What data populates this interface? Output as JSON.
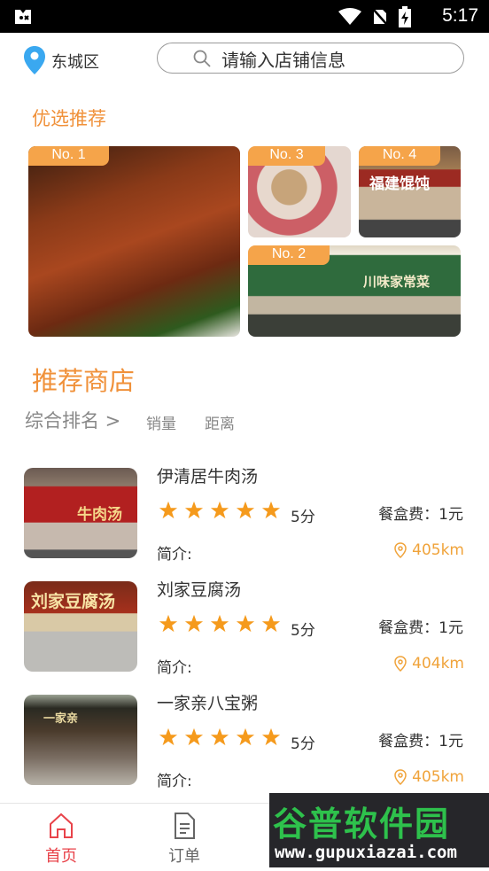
{
  "status_bar": {
    "time": "5:17",
    "icons": [
      "wifi-icon",
      "no-sim-icon",
      "battery-charging-icon"
    ]
  },
  "header": {
    "location": "东城区",
    "search_placeholder": "请输入店铺信息"
  },
  "featured": {
    "title": "优选推荐",
    "items": [
      {
        "badge": "No. 1"
      },
      {
        "badge": "No. 3"
      },
      {
        "badge": "No. 4",
        "sign": "福建馄饨"
      },
      {
        "badge": "No. 2",
        "sign": "川味家常菜"
      }
    ]
  },
  "recommend": {
    "title": "推荐商店",
    "sort": {
      "main": "综合排名 >",
      "sales": "销量",
      "distance": "距离"
    }
  },
  "stores": [
    {
      "name": "伊清居牛肉汤",
      "rating": 5,
      "score": "5分",
      "box_fee": "餐盒费：1元",
      "intro": "简介:",
      "distance": "405km",
      "sign": "牛肉汤"
    },
    {
      "name": "刘家豆腐汤",
      "rating": 5,
      "score": "5分",
      "box_fee": "餐盒费：1元",
      "intro": "简介:",
      "distance": "404km",
      "sign": "刘家豆腐汤"
    },
    {
      "name": "一家亲八宝粥",
      "rating": 5,
      "score": "5分",
      "box_fee": "餐盒费：1元",
      "intro": "简介:",
      "distance": "405km",
      "sign": "一家亲"
    }
  ],
  "tabs": [
    {
      "label": "首页",
      "active": true
    },
    {
      "label": "订单",
      "active": false
    }
  ],
  "watermark": {
    "top": "谷普软件园",
    "bottom": "www.gupuxiazai.com"
  },
  "colors": {
    "accent_orange": "#f0913a",
    "star_orange": "#f59a1c",
    "tab_active_red": "#e8434a"
  }
}
